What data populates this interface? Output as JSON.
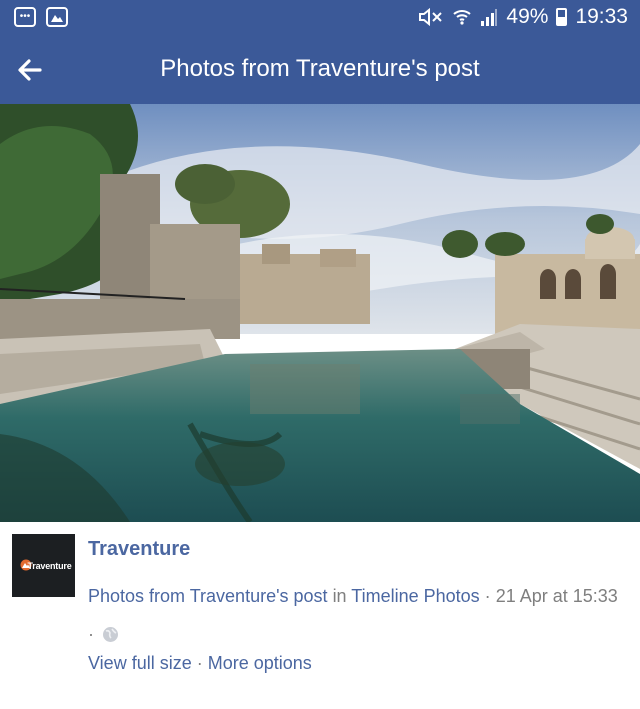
{
  "status_bar": {
    "battery_percent": "49%",
    "battery_level": 0.49,
    "time": "19:33",
    "icons": [
      "messages-icon",
      "gallery-icon",
      "mute-icon",
      "wifi-icon",
      "signal-icon",
      "battery-icon"
    ]
  },
  "app_bar": {
    "back_icon": "arrow-left-icon",
    "title": "Photos from Traventure's post"
  },
  "photo": {
    "description_icon": "photo-image"
  },
  "post": {
    "avatar_text": "Traventure",
    "page_name": "Traventure",
    "desc_prefix": "Photos from Traventure's post",
    "desc_in": "in",
    "album": "Timeline Photos",
    "sep1": "·",
    "date": "21 Apr at 15:33",
    "sep2": "·",
    "privacy_icon": "globe-icon",
    "view_full_size": "View full size",
    "sep3": "·",
    "more_options": "More options"
  },
  "colors": {
    "brand_blue": "#3b5998",
    "link_blue": "#4b67a1",
    "muted_gray": "#7f7f7f"
  }
}
